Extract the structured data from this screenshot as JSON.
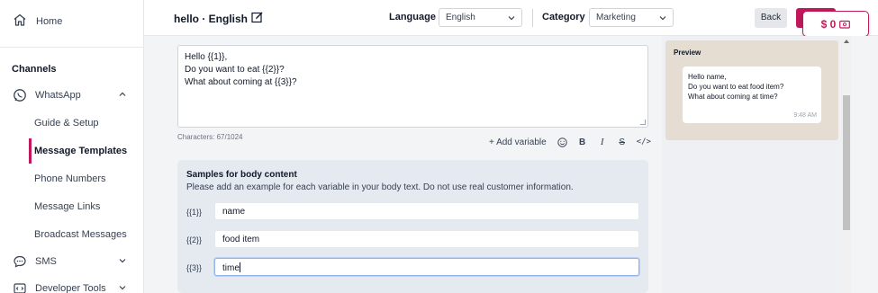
{
  "sidebar": {
    "home_label": "Home",
    "section_label": "Channels",
    "whatsapp_label": "WhatsApp",
    "sub_items": [
      {
        "label": "Guide & Setup"
      },
      {
        "label": "Message Templates"
      },
      {
        "label": "Phone Numbers"
      },
      {
        "label": "Message Links"
      },
      {
        "label": "Broadcast Messages"
      }
    ],
    "sms_label": "SMS",
    "dev_tools_label": "Developer Tools"
  },
  "header": {
    "title": "hello · English",
    "language_label": "Language",
    "language_value": "English",
    "category_label": "Category",
    "category_value": "Marketing",
    "back_label": "Back",
    "balance": "$ 0"
  },
  "editor": {
    "body_lines": [
      "Hello {{1}},",
      "Do you want to eat {{2}}?",
      "What about coming at {{3}}?"
    ],
    "char_count": "Characters: 67/1024",
    "add_variable": "+ Add variable",
    "bold": "B",
    "italic": "I",
    "strike": "S",
    "code": "</>"
  },
  "samples": {
    "title": "Samples for body content",
    "description": "Please add an example for each variable in your body text. Do not use real customer information.",
    "rows": [
      {
        "var": "{{1}}",
        "value": "name"
      },
      {
        "var": "{{2}}",
        "value": "food item"
      },
      {
        "var": "{{3}}",
        "value": "time"
      }
    ]
  },
  "preview": {
    "title": "Preview",
    "lines": [
      "Hello name,",
      "Do you want to eat food item?",
      "What about coming at time?"
    ],
    "time": "9:48 AM"
  },
  "colors": {
    "accent": "#c2185b",
    "preview_bg": "#e6ddd2"
  },
  "icons": [
    "home-icon",
    "whatsapp-icon",
    "chevron-up-icon",
    "chat-icon",
    "chevron-down-icon",
    "code-icon",
    "edit-icon",
    "emoji-icon",
    "wallet-icon"
  ]
}
